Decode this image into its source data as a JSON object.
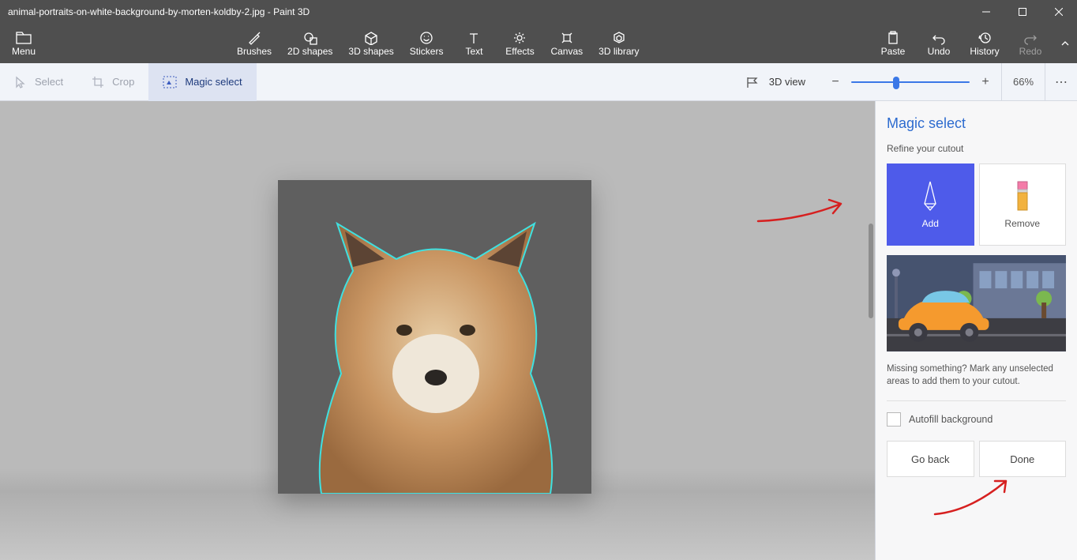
{
  "window": {
    "title": "animal-portraits-on-white-background-by-morten-koldby-2.jpg - Paint 3D"
  },
  "ribbon": {
    "menu": "Menu",
    "brushes": "Brushes",
    "shapes2d": "2D shapes",
    "shapes3d": "3D shapes",
    "stickers": "Stickers",
    "text": "Text",
    "effects": "Effects",
    "canvas": "Canvas",
    "library3d": "3D library",
    "paste": "Paste",
    "undo": "Undo",
    "history": "History",
    "redo": "Redo"
  },
  "toolbar": {
    "select": "Select",
    "crop": "Crop",
    "magic_select": "Magic select",
    "view3d": "3D view",
    "zoom": "66%"
  },
  "sidepanel": {
    "title": "Magic select",
    "refine": "Refine your cutout",
    "add": "Add",
    "remove": "Remove",
    "help": "Missing something? Mark any unselected areas to add them to your cutout.",
    "autofill": "Autofill background",
    "go_back": "Go back",
    "done": "Done"
  },
  "slider": {
    "position_pct": 35
  }
}
